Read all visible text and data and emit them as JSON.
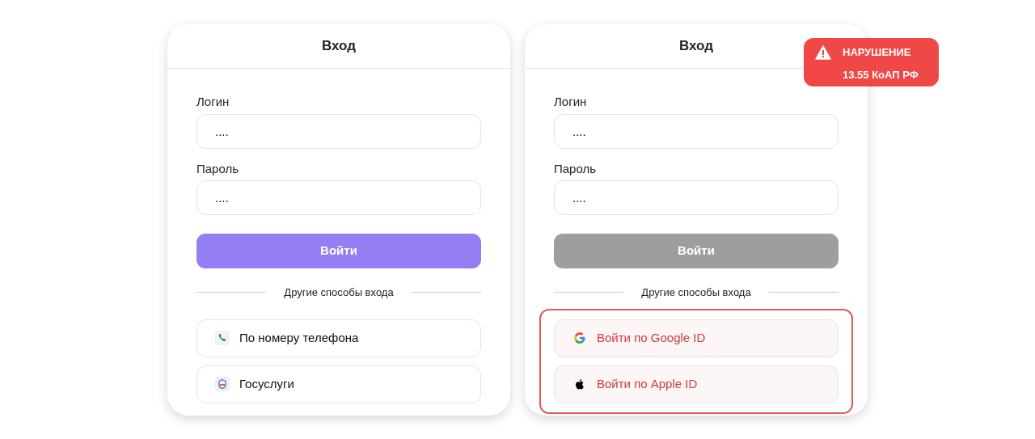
{
  "cards": [
    {
      "title": "Вход",
      "fields": [
        {
          "label": "Логин",
          "value": "...."
        },
        {
          "label": "Пароль",
          "value": "...."
        }
      ],
      "submit": {
        "label": "Войти",
        "disabled": false
      },
      "divider": "Другие способы входа",
      "alt_highlighted": false,
      "alt_buttons": [
        {
          "kind": "phone",
          "label": "По номеру телефона"
        },
        {
          "kind": "gosuslugi",
          "label": "Госуслуги"
        }
      ]
    },
    {
      "title": "Вход",
      "fields": [
        {
          "label": "Логин",
          "value": "...."
        },
        {
          "label": "Пароль",
          "value": "...."
        }
      ],
      "submit": {
        "label": "Войти",
        "disabled": true
      },
      "divider": "Другие способы входа",
      "alt_highlighted": true,
      "alt_buttons": [
        {
          "kind": "google",
          "label": "Войти по Google ID"
        },
        {
          "kind": "apple",
          "label": "Войти по Apple ID"
        }
      ]
    }
  ],
  "badge": {
    "title": "НАРУШЕНИЕ",
    "subtitle": "13.55 КоАП РФ"
  }
}
